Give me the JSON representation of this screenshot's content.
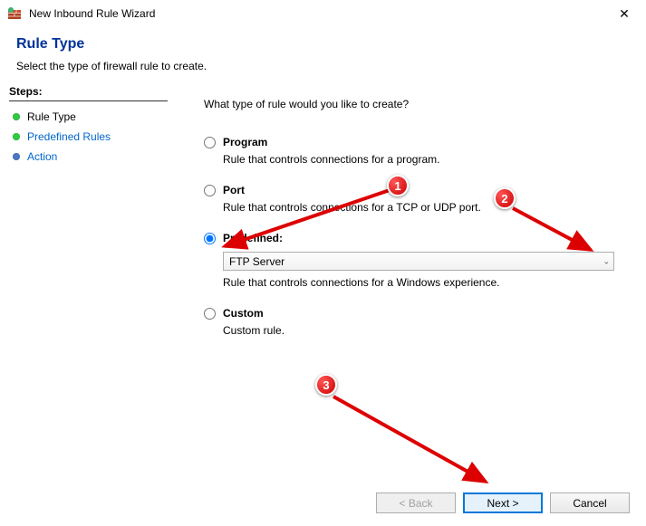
{
  "window": {
    "title": "New Inbound Rule Wizard"
  },
  "header": {
    "title": "Rule Type",
    "subtitle": "Select the type of firewall rule to create."
  },
  "sidebar": {
    "heading": "Steps:",
    "items": [
      {
        "label": "Rule Type"
      },
      {
        "label": "Predefined Rules"
      },
      {
        "label": "Action"
      }
    ]
  },
  "content": {
    "question": "What type of rule would you like to create?",
    "options": {
      "program": {
        "label": "Program",
        "desc": "Rule that controls connections for a program."
      },
      "port": {
        "label": "Port",
        "desc": "Rule that controls connections for a TCP or UDP port."
      },
      "predefined": {
        "label": "Predefined:",
        "desc": "Rule that controls connections for a Windows experience.",
        "value": "FTP Server"
      },
      "custom": {
        "label": "Custom",
        "desc": "Custom rule."
      }
    }
  },
  "buttons": {
    "back": "< Back",
    "next": "Next >",
    "cancel": "Cancel"
  },
  "annotations": {
    "c1": "1",
    "c2": "2",
    "c3": "3"
  }
}
